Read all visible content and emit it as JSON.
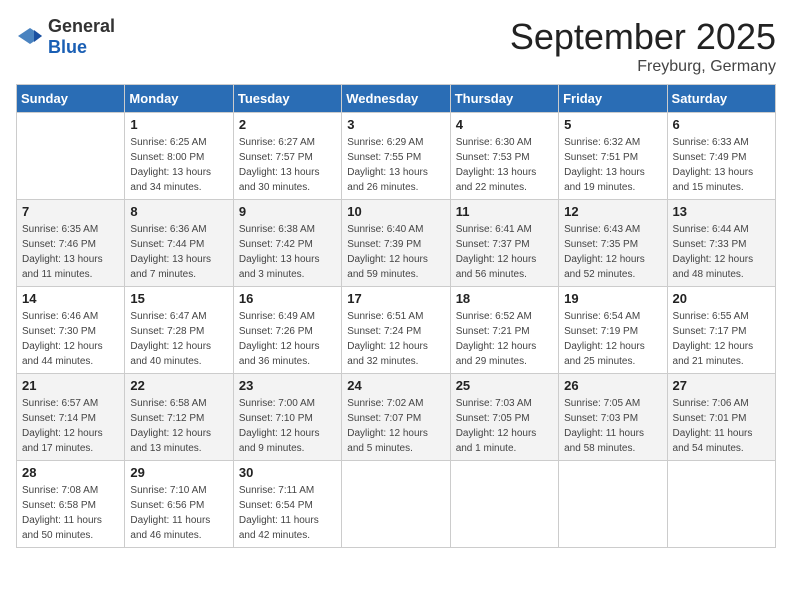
{
  "header": {
    "logo_general": "General",
    "logo_blue": "Blue",
    "month_title": "September 2025",
    "location": "Freyburg, Germany"
  },
  "days_of_week": [
    "Sunday",
    "Monday",
    "Tuesday",
    "Wednesday",
    "Thursday",
    "Friday",
    "Saturday"
  ],
  "weeks": [
    [
      {
        "day": "",
        "sunrise": "",
        "sunset": "",
        "daylight": ""
      },
      {
        "day": "1",
        "sunrise": "Sunrise: 6:25 AM",
        "sunset": "Sunset: 8:00 PM",
        "daylight": "Daylight: 13 hours and 34 minutes."
      },
      {
        "day": "2",
        "sunrise": "Sunrise: 6:27 AM",
        "sunset": "Sunset: 7:57 PM",
        "daylight": "Daylight: 13 hours and 30 minutes."
      },
      {
        "day": "3",
        "sunrise": "Sunrise: 6:29 AM",
        "sunset": "Sunset: 7:55 PM",
        "daylight": "Daylight: 13 hours and 26 minutes."
      },
      {
        "day": "4",
        "sunrise": "Sunrise: 6:30 AM",
        "sunset": "Sunset: 7:53 PM",
        "daylight": "Daylight: 13 hours and 22 minutes."
      },
      {
        "day": "5",
        "sunrise": "Sunrise: 6:32 AM",
        "sunset": "Sunset: 7:51 PM",
        "daylight": "Daylight: 13 hours and 19 minutes."
      },
      {
        "day": "6",
        "sunrise": "Sunrise: 6:33 AM",
        "sunset": "Sunset: 7:49 PM",
        "daylight": "Daylight: 13 hours and 15 minutes."
      }
    ],
    [
      {
        "day": "7",
        "sunrise": "Sunrise: 6:35 AM",
        "sunset": "Sunset: 7:46 PM",
        "daylight": "Daylight: 13 hours and 11 minutes."
      },
      {
        "day": "8",
        "sunrise": "Sunrise: 6:36 AM",
        "sunset": "Sunset: 7:44 PM",
        "daylight": "Daylight: 13 hours and 7 minutes."
      },
      {
        "day": "9",
        "sunrise": "Sunrise: 6:38 AM",
        "sunset": "Sunset: 7:42 PM",
        "daylight": "Daylight: 13 hours and 3 minutes."
      },
      {
        "day": "10",
        "sunrise": "Sunrise: 6:40 AM",
        "sunset": "Sunset: 7:39 PM",
        "daylight": "Daylight: 12 hours and 59 minutes."
      },
      {
        "day": "11",
        "sunrise": "Sunrise: 6:41 AM",
        "sunset": "Sunset: 7:37 PM",
        "daylight": "Daylight: 12 hours and 56 minutes."
      },
      {
        "day": "12",
        "sunrise": "Sunrise: 6:43 AM",
        "sunset": "Sunset: 7:35 PM",
        "daylight": "Daylight: 12 hours and 52 minutes."
      },
      {
        "day": "13",
        "sunrise": "Sunrise: 6:44 AM",
        "sunset": "Sunset: 7:33 PM",
        "daylight": "Daylight: 12 hours and 48 minutes."
      }
    ],
    [
      {
        "day": "14",
        "sunrise": "Sunrise: 6:46 AM",
        "sunset": "Sunset: 7:30 PM",
        "daylight": "Daylight: 12 hours and 44 minutes."
      },
      {
        "day": "15",
        "sunrise": "Sunrise: 6:47 AM",
        "sunset": "Sunset: 7:28 PM",
        "daylight": "Daylight: 12 hours and 40 minutes."
      },
      {
        "day": "16",
        "sunrise": "Sunrise: 6:49 AM",
        "sunset": "Sunset: 7:26 PM",
        "daylight": "Daylight: 12 hours and 36 minutes."
      },
      {
        "day": "17",
        "sunrise": "Sunrise: 6:51 AM",
        "sunset": "Sunset: 7:24 PM",
        "daylight": "Daylight: 12 hours and 32 minutes."
      },
      {
        "day": "18",
        "sunrise": "Sunrise: 6:52 AM",
        "sunset": "Sunset: 7:21 PM",
        "daylight": "Daylight: 12 hours and 29 minutes."
      },
      {
        "day": "19",
        "sunrise": "Sunrise: 6:54 AM",
        "sunset": "Sunset: 7:19 PM",
        "daylight": "Daylight: 12 hours and 25 minutes."
      },
      {
        "day": "20",
        "sunrise": "Sunrise: 6:55 AM",
        "sunset": "Sunset: 7:17 PM",
        "daylight": "Daylight: 12 hours and 21 minutes."
      }
    ],
    [
      {
        "day": "21",
        "sunrise": "Sunrise: 6:57 AM",
        "sunset": "Sunset: 7:14 PM",
        "daylight": "Daylight: 12 hours and 17 minutes."
      },
      {
        "day": "22",
        "sunrise": "Sunrise: 6:58 AM",
        "sunset": "Sunset: 7:12 PM",
        "daylight": "Daylight: 12 hours and 13 minutes."
      },
      {
        "day": "23",
        "sunrise": "Sunrise: 7:00 AM",
        "sunset": "Sunset: 7:10 PM",
        "daylight": "Daylight: 12 hours and 9 minutes."
      },
      {
        "day": "24",
        "sunrise": "Sunrise: 7:02 AM",
        "sunset": "Sunset: 7:07 PM",
        "daylight": "Daylight: 12 hours and 5 minutes."
      },
      {
        "day": "25",
        "sunrise": "Sunrise: 7:03 AM",
        "sunset": "Sunset: 7:05 PM",
        "daylight": "Daylight: 12 hours and 1 minute."
      },
      {
        "day": "26",
        "sunrise": "Sunrise: 7:05 AM",
        "sunset": "Sunset: 7:03 PM",
        "daylight": "Daylight: 11 hours and 58 minutes."
      },
      {
        "day": "27",
        "sunrise": "Sunrise: 7:06 AM",
        "sunset": "Sunset: 7:01 PM",
        "daylight": "Daylight: 11 hours and 54 minutes."
      }
    ],
    [
      {
        "day": "28",
        "sunrise": "Sunrise: 7:08 AM",
        "sunset": "Sunset: 6:58 PM",
        "daylight": "Daylight: 11 hours and 50 minutes."
      },
      {
        "day": "29",
        "sunrise": "Sunrise: 7:10 AM",
        "sunset": "Sunset: 6:56 PM",
        "daylight": "Daylight: 11 hours and 46 minutes."
      },
      {
        "day": "30",
        "sunrise": "Sunrise: 7:11 AM",
        "sunset": "Sunset: 6:54 PM",
        "daylight": "Daylight: 11 hours and 42 minutes."
      },
      {
        "day": "",
        "sunrise": "",
        "sunset": "",
        "daylight": ""
      },
      {
        "day": "",
        "sunrise": "",
        "sunset": "",
        "daylight": ""
      },
      {
        "day": "",
        "sunrise": "",
        "sunset": "",
        "daylight": ""
      },
      {
        "day": "",
        "sunrise": "",
        "sunset": "",
        "daylight": ""
      }
    ]
  ]
}
